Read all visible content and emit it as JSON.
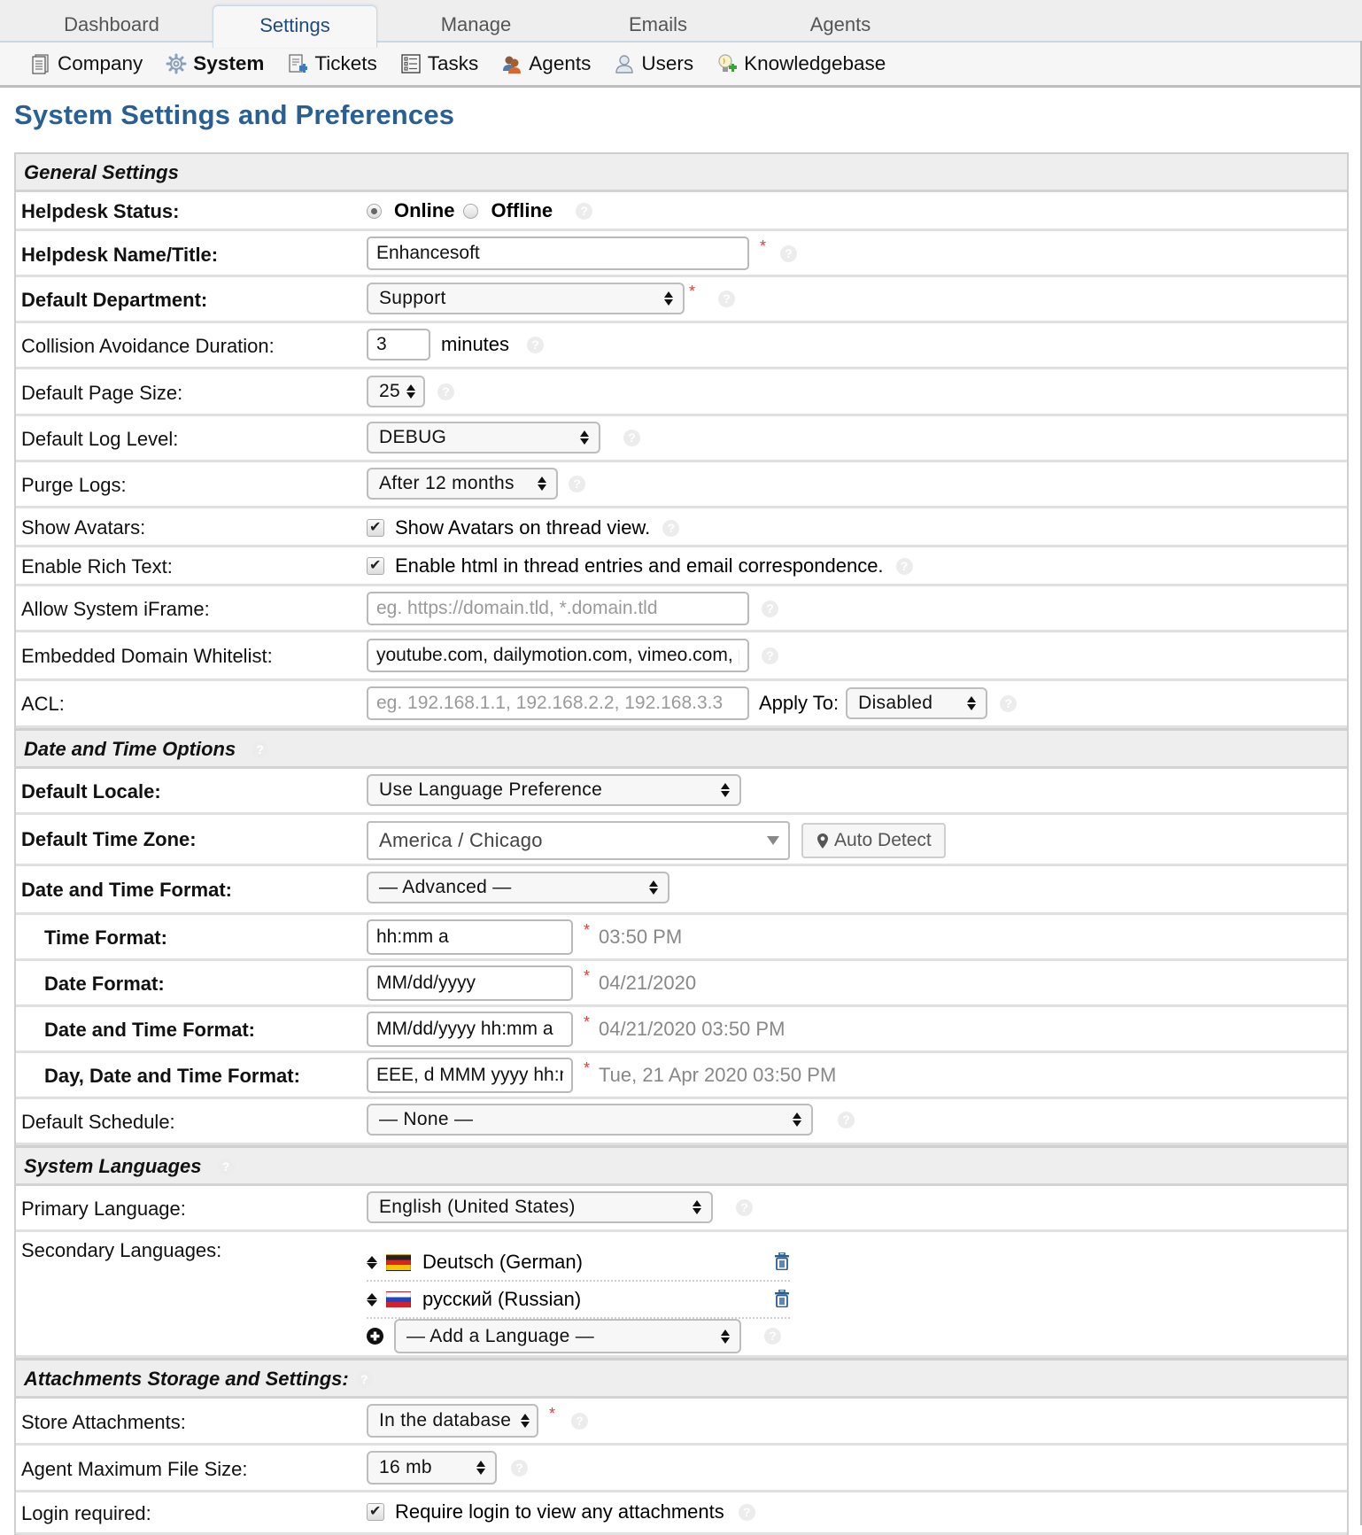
{
  "top_nav": {
    "tabs": [
      {
        "label": "Dashboard",
        "active": false
      },
      {
        "label": "Settings",
        "active": true
      },
      {
        "label": "Manage",
        "active": false
      },
      {
        "label": "Emails",
        "active": false
      },
      {
        "label": "Agents",
        "active": false
      }
    ]
  },
  "sub_nav": {
    "items": [
      {
        "label": "Company",
        "icon": "document-icon",
        "active": false
      },
      {
        "label": "System",
        "icon": "gear-icon",
        "active": true
      },
      {
        "label": "Tickets",
        "icon": "ticket-icon",
        "active": false
      },
      {
        "label": "Tasks",
        "icon": "task-list-icon",
        "active": false
      },
      {
        "label": "Agents",
        "icon": "agents-icon",
        "active": false
      },
      {
        "label": "Users",
        "icon": "user-icon",
        "active": false
      },
      {
        "label": "Knowledgebase",
        "icon": "lightbulb-icon",
        "active": false
      }
    ]
  },
  "page": {
    "title": "System Settings and Preferences"
  },
  "general": {
    "title": "General Settings",
    "helpdesk_status": {
      "label": "Helpdesk Status:",
      "online": "Online",
      "offline": "Offline",
      "selected": "Online"
    },
    "helpdesk_name": {
      "label": "Helpdesk Name/Title:",
      "value": "Enhancesoft",
      "required": "*"
    },
    "default_department": {
      "label": "Default Department:",
      "value": "Support",
      "required": "*"
    },
    "collision": {
      "label": "Collision Avoidance Duration:",
      "value": "3",
      "unit": "minutes"
    },
    "page_size": {
      "label": "Default Page Size:",
      "value": "25"
    },
    "log_level": {
      "label": "Default Log Level:",
      "value": "DEBUG"
    },
    "purge_logs": {
      "label": "Purge Logs:",
      "value": "After 12 months"
    },
    "show_avatars": {
      "label": "Show Avatars:",
      "text": "Show Avatars on thread view.",
      "checked": true
    },
    "rich_text": {
      "label": "Enable Rich Text:",
      "text": "Enable html in thread entries and email correspondence.",
      "checked": true
    },
    "iframe": {
      "label": "Allow System iFrame:",
      "value": "",
      "placeholder": "eg. https://domain.tld, *.domain.tld"
    },
    "whitelist": {
      "label": "Embedded Domain Whitelist:",
      "value": "youtube.com, dailymotion.com, vimeo.com, player.vimeo.com, web.microsoftstream.com"
    },
    "acl": {
      "label": "ACL:",
      "value": "",
      "placeholder": "eg. 192.168.1.1, 192.168.2.2, 192.168.3.3",
      "apply_label": "Apply To:",
      "apply_value": "Disabled"
    }
  },
  "datetime": {
    "title": "Date and Time Options",
    "locale": {
      "label": "Default Locale:",
      "value": "Use Language Preference"
    },
    "timezone": {
      "label": "Default Time Zone:",
      "value": "America / Chicago",
      "auto_detect": "Auto Detect"
    },
    "format": {
      "label": "Date and Time Format:",
      "value": "— Advanced —"
    },
    "time_format": {
      "label": "Time Format:",
      "value": "hh:mm a",
      "required": "*",
      "preview": "03:50 PM"
    },
    "date_format": {
      "label": "Date Format:",
      "value": "MM/dd/yyyy",
      "required": "*",
      "preview": "04/21/2020"
    },
    "datetime_format": {
      "label": "Date and Time Format:",
      "value": "MM/dd/yyyy hh:mm a",
      "required": "*",
      "preview": "04/21/2020 03:50 PM"
    },
    "day_datetime_format": {
      "label": "Day, Date and Time Format:",
      "value": "EEE, d MMM yyyy hh:mm a",
      "required": "*",
      "preview": "Tue, 21 Apr 2020 03:50 PM"
    },
    "schedule": {
      "label": "Default Schedule:",
      "value": "— None —"
    }
  },
  "languages": {
    "title": "System Languages",
    "primary": {
      "label": "Primary Language:",
      "value": "English (United States)"
    },
    "secondary": {
      "label": "Secondary Languages:",
      "items": [
        {
          "name": "Deutsch (German)",
          "flag": "de"
        },
        {
          "name": "русский (Russian)",
          "flag": "ru"
        }
      ],
      "add_placeholder": "— Add a Language —"
    }
  },
  "attachments": {
    "title": "Attachments Storage and Settings:",
    "store": {
      "label": "Store Attachments:",
      "value": "In the database",
      "required": "*"
    },
    "max_size": {
      "label": "Agent Maximum File Size:",
      "value": "16 mb"
    },
    "login": {
      "label": "Login required:",
      "text": "Require login to view any attachments",
      "checked": true
    }
  },
  "colors": {
    "accent": "#2a5f94",
    "required": "#e53935",
    "section_bg": "#eeeeee"
  }
}
